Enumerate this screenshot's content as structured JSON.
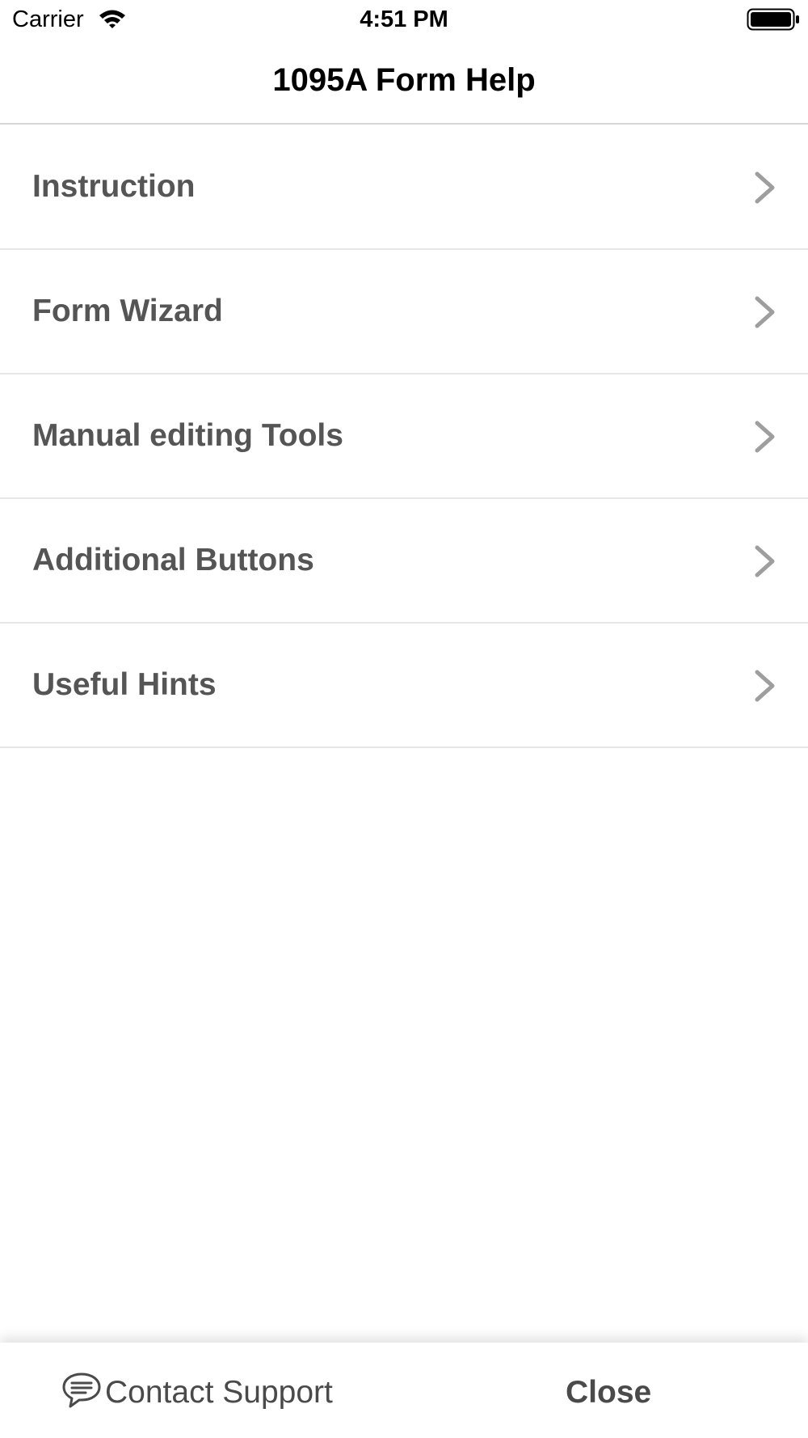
{
  "status_bar": {
    "carrier": "Carrier",
    "time": "4:51 PM",
    "wifi_icon": "wifi-icon",
    "battery_icon": "battery-icon"
  },
  "nav": {
    "title": "1095A Form Help"
  },
  "menu": {
    "items": [
      {
        "label": "Instruction",
        "icon": "chevron-right-icon"
      },
      {
        "label": "Form Wizard",
        "icon": "chevron-right-icon"
      },
      {
        "label": "Manual editing Tools",
        "icon": "chevron-right-icon"
      },
      {
        "label": "Additional Buttons",
        "icon": "chevron-right-icon"
      },
      {
        "label": "Useful Hints",
        "icon": "chevron-right-icon"
      }
    ]
  },
  "footer": {
    "contact_label": "Contact Support",
    "contact_icon": "chat-bubble-icon",
    "close_label": "Close"
  },
  "colors": {
    "label_gray": "#555555",
    "chevron_gray": "#9e9e9e",
    "separator": "#e6e6e6"
  }
}
